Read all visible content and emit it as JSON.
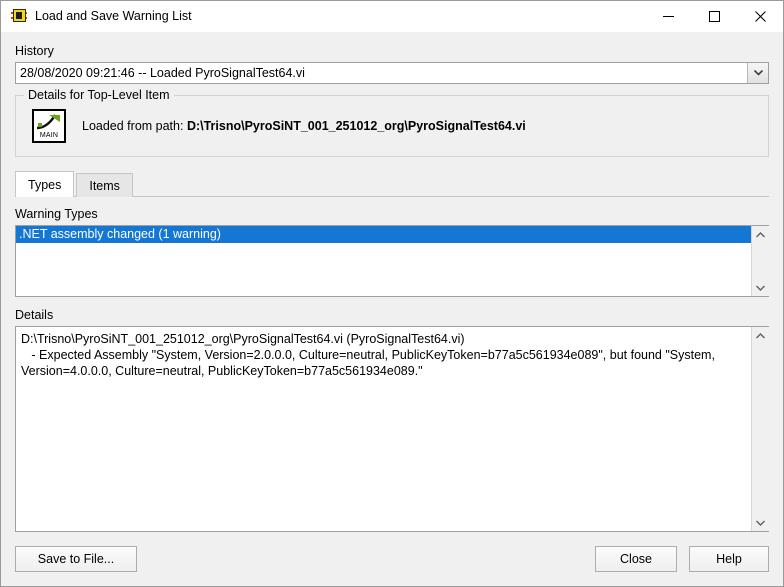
{
  "window": {
    "title": "Load and Save Warning List",
    "icon": "labview-vi-icon",
    "controls": {
      "minimize": "minimize-icon",
      "maximize": "maximize-icon",
      "close": "close-icon"
    }
  },
  "history": {
    "label": "History",
    "value": "28/08/2020 09:21:46 -- Loaded PyroSignalTest64.vi",
    "dropdown_icon": "chevron-down-icon"
  },
  "top_level": {
    "group_title": "Details for Top-Level Item",
    "icon_caption": "MAIN",
    "prefix": "Loaded from path: ",
    "path": "D:\\Trisno\\PyroSiNT_001_251012_org\\PyroSignalTest64.vi"
  },
  "tabs": [
    {
      "label": "Types",
      "active": true
    },
    {
      "label": "Items",
      "active": false
    }
  ],
  "warning_types": {
    "label": "Warning Types",
    "items": [
      {
        "text": ".NET assembly changed (1 warning)",
        "selected": true
      }
    ],
    "scrollbar": {
      "up_icon": "chevron-up-icon",
      "down_icon": "chevron-down-icon"
    }
  },
  "details": {
    "label": "Details",
    "text": "D:\\Trisno\\PyroSiNT_001_251012_org\\PyroSignalTest64.vi (PyroSignalTest64.vi)\n   - Expected Assembly \"System, Version=2.0.0.0, Culture=neutral, PublicKeyToken=b77a5c561934e089\", but found \"System, Version=4.0.0.0, Culture=neutral, PublicKeyToken=b77a5c561934e089.\"",
    "scrollbar": {
      "up_icon": "chevron-up-icon",
      "down_icon": "chevron-down-icon"
    }
  },
  "footer": {
    "save_label": "Save to File...",
    "close_label": "Close",
    "help_label": "Help"
  },
  "colors": {
    "selection": "#1577d4",
    "dialog_background": "#f0f0f0",
    "titlebar": "#ffffff",
    "field_background": "#ffffff",
    "icon_yellow": "#f2d80c",
    "icon_green": "#6aa515"
  }
}
